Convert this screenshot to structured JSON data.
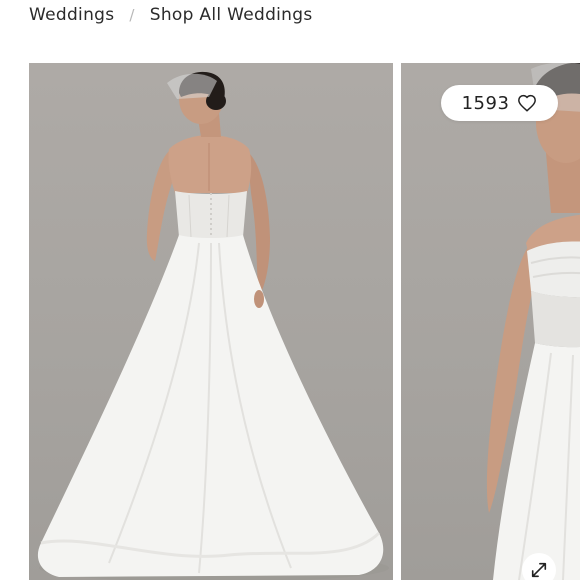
{
  "breadcrumb": {
    "items": [
      {
        "label": "Weddings"
      },
      {
        "label": "Shop All Weddings"
      }
    ],
    "separator": "/"
  },
  "gallery": {
    "images": [
      {
        "alt": "",
        "icon": "back-view-dress-photo"
      },
      {
        "alt": "",
        "icon": "front-view-dress-photo"
      }
    ],
    "likes_count": "1593",
    "like_icon": "heart-outline-icon",
    "expand_icon": "expand-arrows-icon"
  },
  "colors": {
    "photo_background": "#a9a5a1",
    "dress": "#f4f4f2",
    "skin": "#c89c82",
    "hair": "#221c19",
    "text": "#2b2b2b"
  }
}
